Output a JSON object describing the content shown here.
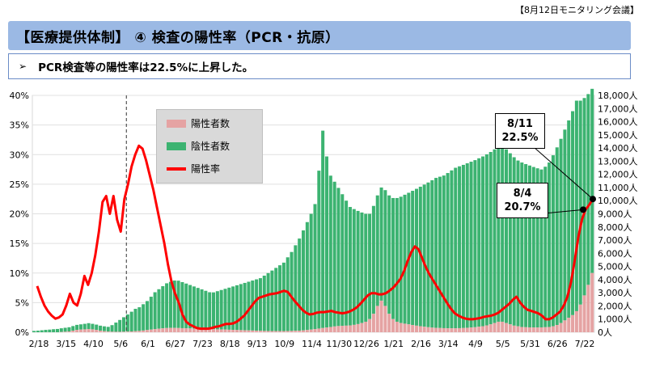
{
  "meeting_label": "【8月12日モニタリング会議】",
  "title": "【医療提供体制】 ④ 検査の陽性率（PCR・抗原）",
  "subtitle_arrow": "➢",
  "subtitle": "PCR検査等の陽性率は22.5%に上昇した。",
  "legend": {
    "positive": "陽性者数",
    "negative": "陰性者数",
    "rate": "陽性率"
  },
  "callouts": [
    {
      "date": "8/11",
      "value": "22.5%"
    },
    {
      "date": "8/4",
      "value": "20.7%"
    }
  ],
  "colors": {
    "positive": "#e5a3a3",
    "negative": "#3cb371",
    "rate": "#ff0000",
    "title_bg": "#9bb9e4"
  },
  "chart_data": {
    "type": "bar+line",
    "x_tick_labels": [
      "2/18",
      "3/15",
      "4/10",
      "5/6",
      "6/1",
      "6/27",
      "7/23",
      "8/18",
      "9/13",
      "10/9",
      "11/4",
      "11/30",
      "12/26",
      "1/21",
      "2/16",
      "3/14",
      "4/9",
      "5/5",
      "5/31",
      "6/26",
      "7/22"
    ],
    "y_left_ticks": [
      "0%",
      "5%",
      "10%",
      "15%",
      "20%",
      "25%",
      "30%",
      "35%",
      "40%"
    ],
    "y_right_ticks": [
      "0人",
      "1,000人",
      "2,000人",
      "3,000人",
      "4,000人",
      "5,000人",
      "6,000人",
      "7,000人",
      "8,000人",
      "9,000人",
      "10,000人",
      "11,000人",
      "12,000人",
      "13,000人",
      "14,000人",
      "15,000人",
      "16,000人",
      "17,000人",
      "18,000人"
    ],
    "y_left_range": [
      0,
      40
    ],
    "y_right_range": [
      0,
      18000
    ],
    "series": [
      {
        "name": "陽性者数",
        "axis": "right",
        "values": [
          0,
          0,
          0,
          0,
          0,
          0,
          0,
          20,
          40,
          60,
          120,
          180,
          200,
          220,
          240,
          220,
          180,
          120,
          80,
          50,
          40,
          35,
          35,
          40,
          50,
          60,
          80,
          100,
          130,
          170,
          200,
          240,
          270,
          300,
          320,
          330,
          330,
          320,
          310,
          300,
          290,
          280,
          270,
          260,
          250,
          240,
          230,
          220,
          210,
          200,
          190,
          180,
          170,
          160,
          150,
          140,
          130,
          120,
          110,
          100,
          95,
          90,
          90,
          90,
          90,
          95,
          100,
          110,
          120,
          140,
          170,
          200,
          240,
          280,
          320,
          360,
          400,
          440,
          470,
          490,
          500,
          520,
          560,
          620,
          700,
          800,
          1000,
          1400,
          2000,
          2400,
          2000,
          1400,
          1000,
          800,
          700,
          650,
          600,
          550,
          500,
          460,
          420,
          380,
          350,
          330,
          320,
          310,
          300,
          300,
          300,
          310,
          320,
          340,
          360,
          380,
          420,
          460,
          520,
          600,
          700,
          800,
          800,
          700,
          600,
          500,
          450,
          400,
          380,
          370,
          360,
          360,
          370,
          380,
          400,
          450,
          550,
          700,
          900,
          1100,
          1300,
          1600,
          2100,
          2800,
          3600,
          4500,
          4000
        ]
      },
      {
        "name": "陰性者数",
        "axis": "right",
        "values": [
          100,
          120,
          150,
          180,
          200,
          230,
          250,
          280,
          300,
          320,
          350,
          380,
          400,
          420,
          450,
          420,
          400,
          380,
          370,
          360,
          500,
          700,
          900,
          1100,
          1300,
          1500,
          1700,
          1800,
          2000,
          2200,
          2500,
          2800,
          3000,
          3200,
          3400,
          3500,
          3600,
          3600,
          3500,
          3400,
          3300,
          3200,
          3100,
          3000,
          2900,
          2800,
          2800,
          2900,
          3000,
          3100,
          3200,
          3300,
          3400,
          3500,
          3600,
          3700,
          3800,
          3900,
          4000,
          4200,
          4400,
          4600,
          4800,
          5000,
          5200,
          5600,
          6000,
          6500,
          7000,
          7600,
          8200,
          8800,
          9500,
          12000,
          15000,
          13000,
          11500,
          11000,
          10500,
          10000,
          9500,
          9000,
          8800,
          8600,
          8400,
          8200,
          8000,
          8200,
          8400,
          8600,
          8800,
          9000,
          9200,
          9400,
          9600,
          9800,
          10000,
          10200,
          10400,
          10600,
          10800,
          11000,
          11200,
          11400,
          11500,
          11600,
          11800,
          12000,
          12200,
          12300,
          12400,
          12500,
          12600,
          12700,
          12800,
          12900,
          13000,
          13100,
          13200,
          13300,
          13400,
          13200,
          13000,
          12800,
          12600,
          12500,
          12400,
          12300,
          12200,
          12100,
          12000,
          12200,
          12500,
          13000,
          13500,
          14000,
          14500,
          15000,
          15500,
          16000,
          15500,
          15000,
          14500,
          14000
        ]
      },
      {
        "name": "陽性率",
        "axis": "left",
        "values": [
          7.8,
          6.0,
          4.5,
          3.5,
          2.8,
          2.3,
          2.5,
          3.0,
          4.5,
          6.5,
          5.0,
          4.5,
          6.5,
          9.5,
          8.0,
          10.0,
          13.0,
          17.0,
          22.0,
          23.0,
          20.0,
          23.0,
          19.0,
          17.0,
          22.5,
          25.0,
          28.0,
          30.0,
          31.5,
          31.0,
          29.0,
          26.5,
          24.0,
          21.0,
          18.0,
          15.0,
          11.5,
          8.5,
          6.5,
          5.0,
          3.0,
          1.8,
          1.3,
          1.0,
          0.7,
          0.6,
          0.6,
          0.6,
          0.7,
          0.9,
          1.0,
          1.2,
          1.4,
          1.4,
          1.5,
          1.8,
          2.3,
          2.8,
          3.6,
          4.4,
          5.2,
          5.8,
          6.0,
          6.2,
          6.4,
          6.5,
          6.6,
          6.8,
          7.0,
          6.8,
          6.0,
          5.2,
          4.5,
          3.8,
          3.3,
          3.0,
          3.1,
          3.3,
          3.4,
          3.4,
          3.5,
          3.6,
          3.4,
          3.3,
          3.2,
          3.3,
          3.5,
          3.8,
          4.2,
          4.8,
          5.5,
          6.2,
          6.6,
          6.6,
          6.4,
          6.4,
          6.6,
          7.0,
          7.5,
          8.2,
          9.0,
          10.3,
          12.0,
          13.5,
          14.5,
          14.0,
          12.5,
          11.0,
          9.8,
          8.8,
          7.8,
          6.8,
          5.8,
          4.8,
          3.9,
          3.2,
          2.8,
          2.5,
          2.3,
          2.2,
          2.2,
          2.3,
          2.4,
          2.6,
          2.7,
          2.8,
          3.0,
          3.3,
          3.8,
          4.3,
          4.8,
          5.5,
          6.0,
          5.0,
          4.3,
          3.8,
          3.6,
          3.4,
          3.2,
          2.8,
          2.2,
          2.2,
          2.5,
          3.0,
          3.5,
          4.5,
          6.0,
          8.5,
          12.0,
          16.0,
          19.0,
          20.7,
          21.5,
          22.5
        ]
      }
    ]
  }
}
